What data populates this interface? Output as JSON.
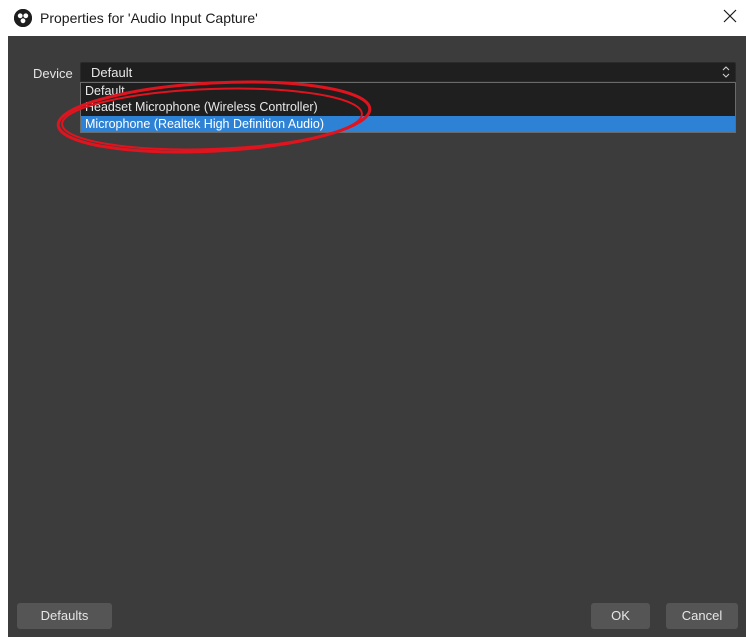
{
  "window": {
    "title": "Properties for 'Audio Input Capture'"
  },
  "device": {
    "label": "Device",
    "selected": "Default",
    "options": [
      {
        "label": "Default"
      },
      {
        "label": "Headset Microphone (Wireless Controller)"
      },
      {
        "label": "Microphone (Realtek High Definition Audio)"
      }
    ],
    "highlighted_index": 2
  },
  "footer": {
    "defaults_label": "Defaults",
    "ok_label": "OK",
    "cancel_label": "Cancel"
  },
  "colors": {
    "panel": "#3c3c3c",
    "highlight": "#2e82d6",
    "annotation": "#e0141e"
  },
  "icons": {
    "app": "obs-logo-icon",
    "close": "close-icon",
    "combo_arrows": "chevron-up-down-icon"
  }
}
